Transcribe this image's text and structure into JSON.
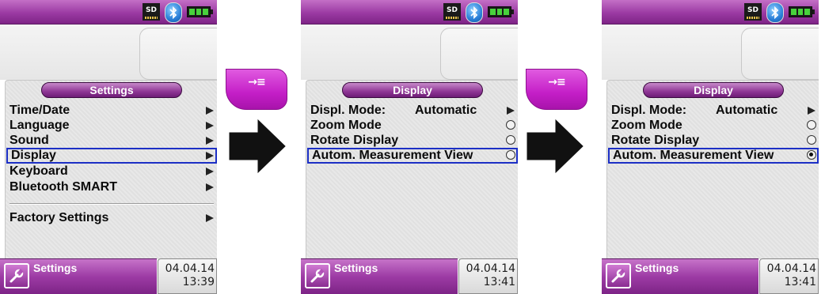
{
  "colors": {
    "accent_purple": "#9b3aa3",
    "selection_blue": "#1c2fc5",
    "key_magenta": "#c41ec7",
    "battery_green": "#48d23c"
  },
  "status_bar": {
    "sd_label": "SD",
    "icons": [
      "sd-card-icon",
      "bluetooth-icon",
      "battery-full-icon"
    ]
  },
  "transition_key": {
    "label": "→≡",
    "icon": "enter-key-icon"
  },
  "transition_arrow_icon": "right-arrow-icon",
  "screens": [
    {
      "title": "Settings",
      "items": [
        {
          "label": "Time/Date",
          "value": "",
          "control": "arrow",
          "selected": false
        },
        {
          "label": "Language",
          "value": "",
          "control": "arrow",
          "selected": false
        },
        {
          "label": "Sound",
          "value": "",
          "control": "arrow",
          "selected": false
        },
        {
          "label": "Display",
          "value": "",
          "control": "arrow",
          "selected": true
        },
        {
          "label": "Keyboard",
          "value": "",
          "control": "arrow",
          "selected": false
        },
        {
          "label": "Bluetooth SMART",
          "value": "",
          "control": "arrow",
          "selected": false
        },
        {
          "label": "Factory Settings",
          "value": "",
          "control": "arrow",
          "selected": false,
          "after_divider": true
        }
      ],
      "bottom": {
        "label": "Settings",
        "icon": "wrench-icon",
        "date": "04.04.14",
        "time": "13:39"
      }
    },
    {
      "title": "Display",
      "items": [
        {
          "label": "Displ. Mode:",
          "value": "Automatic",
          "control": "arrow",
          "selected": false
        },
        {
          "label": "Zoom Mode",
          "value": "",
          "control": "radio",
          "checked": false,
          "selected": false
        },
        {
          "label": "Rotate Display",
          "value": "",
          "control": "radio",
          "checked": false,
          "selected": false
        },
        {
          "label": "Autom. Measurement View",
          "value": "",
          "control": "radio",
          "checked": false,
          "selected": true
        }
      ],
      "bottom": {
        "label": "Settings",
        "icon": "wrench-icon",
        "date": "04.04.14",
        "time": "13:41"
      }
    },
    {
      "title": "Display",
      "items": [
        {
          "label": "Displ. Mode:",
          "value": "Automatic",
          "control": "arrow",
          "selected": false
        },
        {
          "label": "Zoom Mode",
          "value": "",
          "control": "radio",
          "checked": false,
          "selected": false
        },
        {
          "label": "Rotate Display",
          "value": "",
          "control": "radio",
          "checked": false,
          "selected": false
        },
        {
          "label": "Autom. Measurement View",
          "value": "",
          "control": "radio",
          "checked": true,
          "selected": true
        }
      ],
      "bottom": {
        "label": "Settings",
        "icon": "wrench-icon",
        "date": "04.04.14",
        "time": "13:41"
      }
    }
  ]
}
